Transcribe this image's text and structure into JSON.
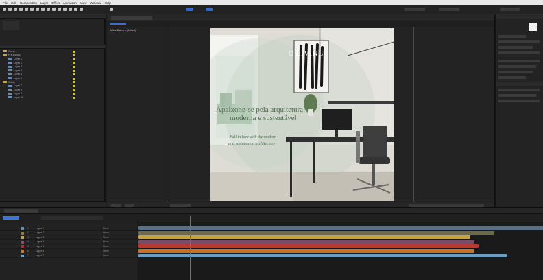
{
  "menu": [
    "File",
    "Edit",
    "Composition",
    "Layer",
    "Effect",
    "Animation",
    "View",
    "Window",
    "Help"
  ],
  "artboard": {
    "brand": "O'LIVING",
    "headline_line1": "Apaixone-se pela arquitetura",
    "headline_line2": "moderna e sustentável",
    "subline1": "Fall in love with the modern",
    "subline2": "and sustainable architecture"
  },
  "comp": {
    "view_label": "Active Camera (Default)"
  },
  "project": {
    "items": [
      {
        "name": "Comp 1",
        "folder": true
      },
      {
        "name": "Pre-comps",
        "folder": true
      },
      {
        "name": "Layer 1",
        "folder": false
      },
      {
        "name": "Layer 2",
        "folder": false
      },
      {
        "name": "Layer 3",
        "folder": false
      },
      {
        "name": "Layer 4",
        "folder": false
      },
      {
        "name": "Layer 5",
        "folder": false
      },
      {
        "name": "Layer 6",
        "folder": false
      },
      {
        "name": "Solids",
        "folder": true
      },
      {
        "name": "Layer 7",
        "folder": false
      },
      {
        "name": "Layer 8",
        "folder": false
      },
      {
        "name": "Layer 9",
        "folder": false
      },
      {
        "name": "Layer 10",
        "folder": false
      }
    ]
  },
  "timeline": {
    "layers": [
      {
        "num": "1",
        "name": "Layer 1",
        "label_color": "#6b8ab0",
        "mode": "None"
      },
      {
        "num": "2",
        "name": "Layer 2",
        "label_color": "#8d7a3a",
        "mode": "None"
      },
      {
        "num": "3",
        "name": "Layer 3",
        "label_color": "#c2a24a",
        "mode": "None"
      },
      {
        "num": "4",
        "name": "Layer 4",
        "label_color": "#8a4d74",
        "mode": "None"
      },
      {
        "num": "5",
        "name": "Layer 5",
        "label_color": "#b03030",
        "mode": "None"
      },
      {
        "num": "6",
        "name": "Layer 6",
        "label_color": "#c27a2a",
        "mode": "None"
      },
      {
        "num": "7",
        "name": "Layer 7",
        "label_color": "#6fa0c2",
        "mode": "None"
      }
    ],
    "bars": [
      {
        "color": "#5a6f84",
        "end_pct": 1.0
      },
      {
        "color": "#6e6a45",
        "end_pct": 0.88
      },
      {
        "color": "#c9a23a",
        "end_pct": 0.82
      },
      {
        "color": "#7a4c6a",
        "end_pct": 0.83
      },
      {
        "color": "#b73a30",
        "end_pct": 0.84
      },
      {
        "color": "#c7702a",
        "end_pct": 0.83
      },
      {
        "color": "#6e9cbc",
        "end_pct": 0.91
      }
    ]
  },
  "colors": {
    "accent": "#2d6bd6",
    "label_yellow": "#c9c23a",
    "headline_green": "#4e6b4f"
  }
}
